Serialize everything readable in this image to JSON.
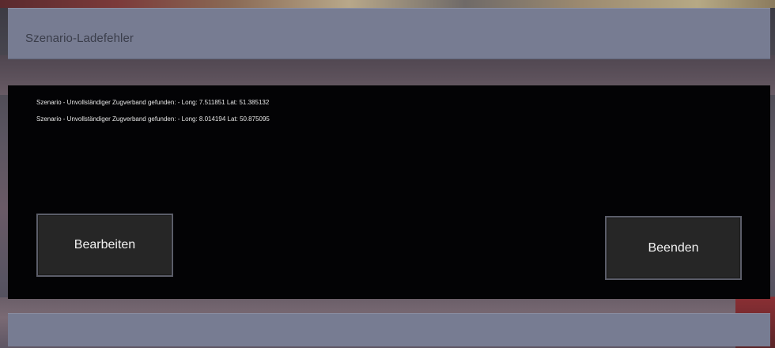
{
  "dialog": {
    "title": "Szenario-Ladefehler"
  },
  "log": {
    "messages": [
      "Szenario - Unvollständiger Zugverband gefunden: - Long: 7.511851 Lat: 51.385132",
      "Szenario - Unvollständiger Zugverband gefunden: - Long: 8.014194 Lat: 50.875095"
    ]
  },
  "buttons": {
    "edit_label": "Bearbeiten",
    "exit_label": "Beenden"
  },
  "colors": {
    "panel_bg": "#777c92",
    "content_bg": "#030305",
    "button_bg": "#262626",
    "button_border": "#5b5d69",
    "title_text": "#3a3d4a"
  }
}
